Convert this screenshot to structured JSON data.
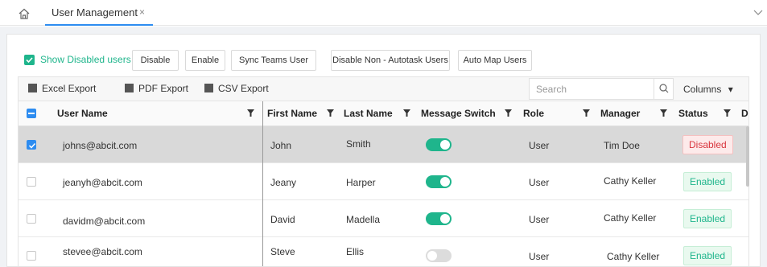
{
  "tabbar": {
    "home_icon": "home-icon",
    "tab_label": "User Management",
    "close_glyph": "×"
  },
  "toolbar": {
    "show_disabled_label": "Show Disabled users",
    "show_disabled_checked": true,
    "buttons": [
      "Disable",
      "Enable",
      "Sync Teams User",
      "Disable Non - Autotask Users",
      "Auto Map Users"
    ]
  },
  "gridbar": {
    "excel_export": "Excel Export",
    "pdf_export": "PDF Export",
    "csv_export": "CSV Export",
    "search_placeholder": "Search",
    "columns_label": "Columns",
    "columns_caret": "▾"
  },
  "table": {
    "headers": {
      "user_name": "User Name",
      "first_name": "First Name",
      "last_name": "Last Name",
      "message_switch": "Message Switch",
      "role": "Role",
      "manager": "Manager",
      "status": "Status",
      "overflow": "D"
    },
    "rows": [
      {
        "user_name": "johns@abcit.com",
        "first_name": "John",
        "last_name": "Smith",
        "message_switch": true,
        "role": "User",
        "manager": "Tim Doe",
        "status": "Disabled",
        "selected": true
      },
      {
        "user_name": "jeanyh@abcit.com",
        "first_name": "Jeany",
        "last_name": "Harper",
        "message_switch": true,
        "role": "User",
        "manager": "Cathy Keller",
        "status": "Enabled",
        "selected": false
      },
      {
        "user_name": "davidm@abcit.com",
        "first_name": "David",
        "last_name": "Madella",
        "message_switch": true,
        "role": "User",
        "manager": "Cathy Keller",
        "status": "Enabled",
        "selected": false
      },
      {
        "user_name": "stevee@abcit.com",
        "first_name": "Steve",
        "last_name": "Ellis",
        "message_switch": false,
        "role": "User",
        "manager": "Cathy Keller",
        "status": "Enabled",
        "selected": false
      }
    ]
  },
  "colors": {
    "accent_green": "#1fb58c",
    "accent_blue": "#2d8cf0",
    "disabled_red": "#d9363e"
  }
}
